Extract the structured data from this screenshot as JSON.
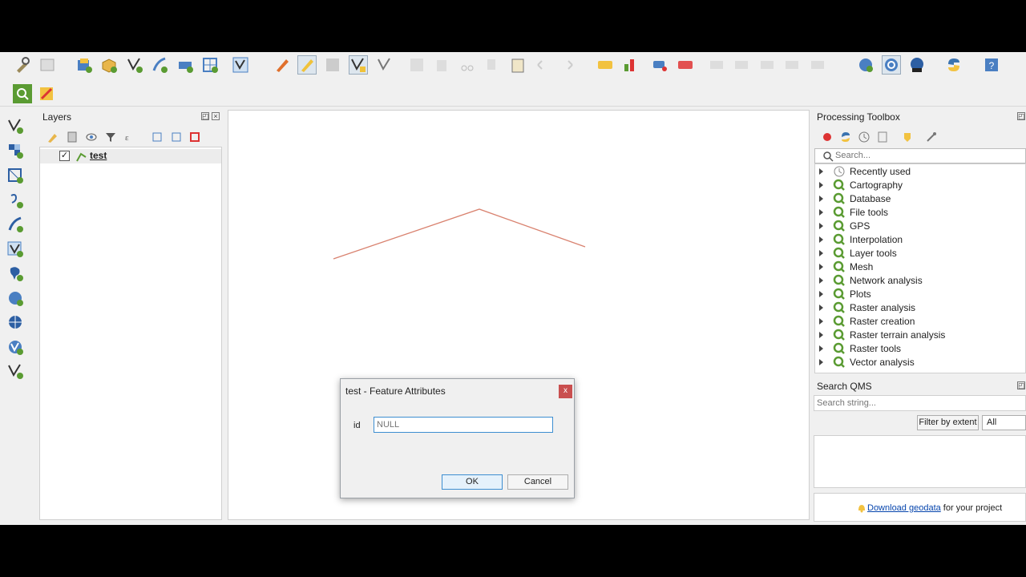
{
  "layers_panel": {
    "title": "Layers",
    "layer": {
      "name": "test",
      "checked": "✓"
    }
  },
  "map": {
    "line_color": "#d9826f"
  },
  "processing_toolbox": {
    "title": "Processing Toolbox",
    "search_placeholder": "Search...",
    "items": [
      {
        "label": "Recently used",
        "icon": "clock-icon"
      },
      {
        "label": "Cartography",
        "icon": "qgis-icon"
      },
      {
        "label": "Database",
        "icon": "qgis-icon"
      },
      {
        "label": "File tools",
        "icon": "qgis-icon"
      },
      {
        "label": "GPS",
        "icon": "qgis-icon"
      },
      {
        "label": "Interpolation",
        "icon": "qgis-icon"
      },
      {
        "label": "Layer tools",
        "icon": "qgis-icon"
      },
      {
        "label": "Mesh",
        "icon": "qgis-icon"
      },
      {
        "label": "Network analysis",
        "icon": "qgis-icon"
      },
      {
        "label": "Plots",
        "icon": "qgis-icon"
      },
      {
        "label": "Raster analysis",
        "icon": "qgis-icon"
      },
      {
        "label": "Raster creation",
        "icon": "qgis-icon"
      },
      {
        "label": "Raster terrain analysis",
        "icon": "qgis-icon"
      },
      {
        "label": "Raster tools",
        "icon": "qgis-icon"
      },
      {
        "label": "Vector analysis",
        "icon": "qgis-icon"
      }
    ]
  },
  "search_qms": {
    "title": "Search QMS",
    "placeholder": "Search string...",
    "filter_button": "Filter by extent",
    "filter_select": "All",
    "footer_link": "Download geodata",
    "footer_text": " for your project"
  },
  "dialog": {
    "title": "test - Feature Attributes",
    "close": "x",
    "field_label": "id",
    "field_placeholder": "NULL",
    "ok": "OK",
    "cancel": "Cancel"
  },
  "colors": {
    "qgis_green": "#5a9b32",
    "accent_blue": "#3d8ed1"
  }
}
